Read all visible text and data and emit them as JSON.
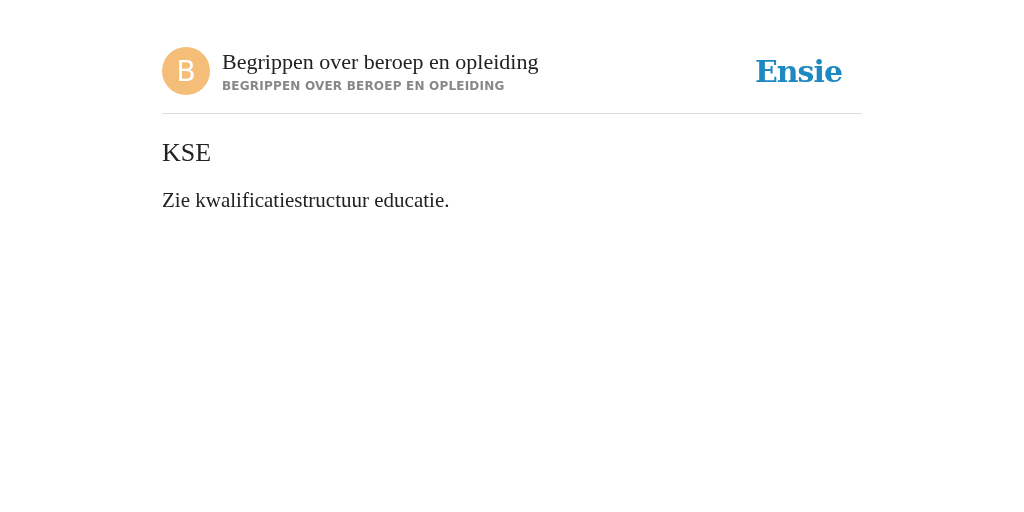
{
  "header": {
    "avatar_letter": "B",
    "title": "Begrippen over beroep en opleiding",
    "subtitle": "BEGRIPPEN OVER BEROEP EN OPLEIDING",
    "logo": "Ensie"
  },
  "entry": {
    "term": "KSE",
    "definition": "Zie kwalificatiestructuur educatie."
  }
}
